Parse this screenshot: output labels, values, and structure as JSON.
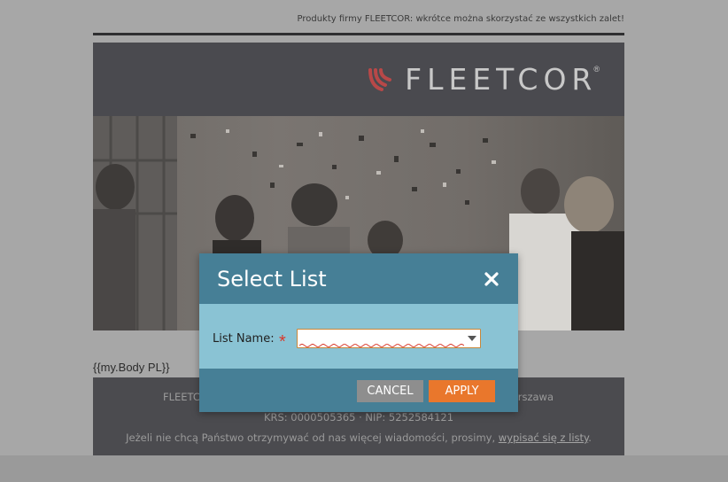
{
  "email": {
    "preheader": "Produkty firmy FLEETCOR: wkrótce można skorzystać ze wszystkich zalet!",
    "logo": {
      "text": "FLEETCOR",
      "registered": "®",
      "icon": "fleetcor-logo-icon",
      "brand_color": "#e0463c"
    },
    "hero_image": {
      "icon": "celebration-photo"
    },
    "body_token": "{{my.Body PL}}",
    "footer": {
      "line1_left": "FLEETC",
      "line1_right": "arszawa",
      "line2": "KRS: 0000505365 · NIP: 5252584121",
      "line3_prefix": "Jeżeli nie chcą Państwo otrzymywać od nas więcej wiadomości, prosimy, ",
      "line3_link": "wypisać się z listy",
      "line3_suffix": "."
    }
  },
  "dialog": {
    "title": "Select List",
    "close_icon": "close-icon",
    "field_label": "List Name:",
    "required_mark": "*",
    "list_value": "",
    "cancel_label": "CANCEL",
    "apply_label": "APPLY",
    "colors": {
      "header": "#467f96",
      "body": "#8ac3d4",
      "apply": "#e9772c",
      "cancel": "#8e8e8e"
    }
  }
}
